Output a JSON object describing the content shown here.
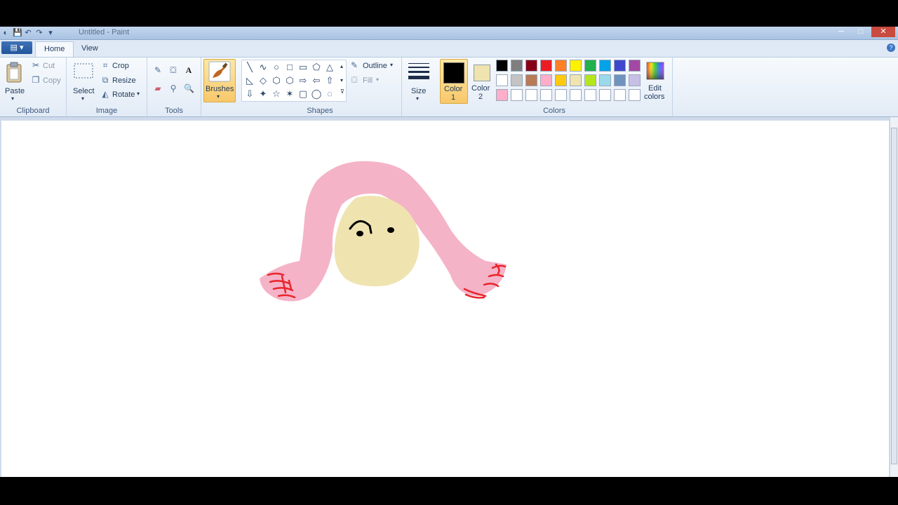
{
  "window": {
    "title": "Untitled - Paint",
    "controls": {
      "minimize": "─",
      "maximize": "□",
      "close": "✕"
    }
  },
  "quick_access": {
    "save": "💾",
    "undo": "↶",
    "redo": "↷",
    "dropdown": "▾"
  },
  "app_menu": {
    "label": "▤ ▾"
  },
  "tabs": [
    {
      "label": "Home",
      "active": true
    },
    {
      "label": "View",
      "active": false
    }
  ],
  "help": "?",
  "ribbon": {
    "clipboard": {
      "group_label": "Clipboard",
      "paste": "Paste",
      "cut": "Cut",
      "copy": "Copy"
    },
    "image": {
      "group_label": "Image",
      "select": "Select",
      "crop": "Crop",
      "resize": "Resize",
      "rotate": "Rotate"
    },
    "tools": {
      "group_label": "Tools",
      "text_tool": "A"
    },
    "brushes": {
      "label": "Brushes"
    },
    "shapes": {
      "group_label": "Shapes",
      "outline": "Outline",
      "fill": "Fill",
      "shape_glyphs": [
        "╲",
        "∿",
        "○",
        "□",
        "▭",
        "⬠",
        "△",
        "◺",
        "◇",
        "⬡",
        "⬡",
        "⇨",
        "⇦",
        "⇧",
        "⇩",
        "✦",
        "☆",
        "✶",
        "▢",
        "◯",
        "◌"
      ]
    },
    "size": {
      "label": "Size"
    },
    "colors": {
      "group_label": "Colors",
      "color1_label": "Color",
      "color1_num": "1",
      "color1_value": "#000000",
      "color2_label": "Color",
      "color2_num": "2",
      "color2_value": "#efe4b0",
      "edit_label": "Edit",
      "edit_label2": "colors",
      "palette": [
        [
          "#000000",
          "#7f7f7f",
          "#880015",
          "#ed1c24",
          "#ff7f27",
          "#fff200",
          "#22b14c",
          "#00a2e8",
          "#3f48cc",
          "#a349a4"
        ],
        [
          "#ffffff",
          "#c3c3c3",
          "#b97a57",
          "#ffaec9",
          "#ffc90e",
          "#efe4b0",
          "#b5e61d",
          "#99d9ea",
          "#7092be",
          "#c8bfe7"
        ],
        [
          "#ffaec9",
          "#ffffff",
          "#ffffff",
          "#ffffff",
          "#ffffff",
          "#ffffff",
          "#ffffff",
          "#ffffff",
          "#ffffff",
          "#ffffff"
        ]
      ]
    }
  },
  "drawing": {
    "hair_color": "#f5b3c8",
    "face_color": "#efe4b0",
    "ink_color": "#000000",
    "nail_color": "#e8252b"
  }
}
